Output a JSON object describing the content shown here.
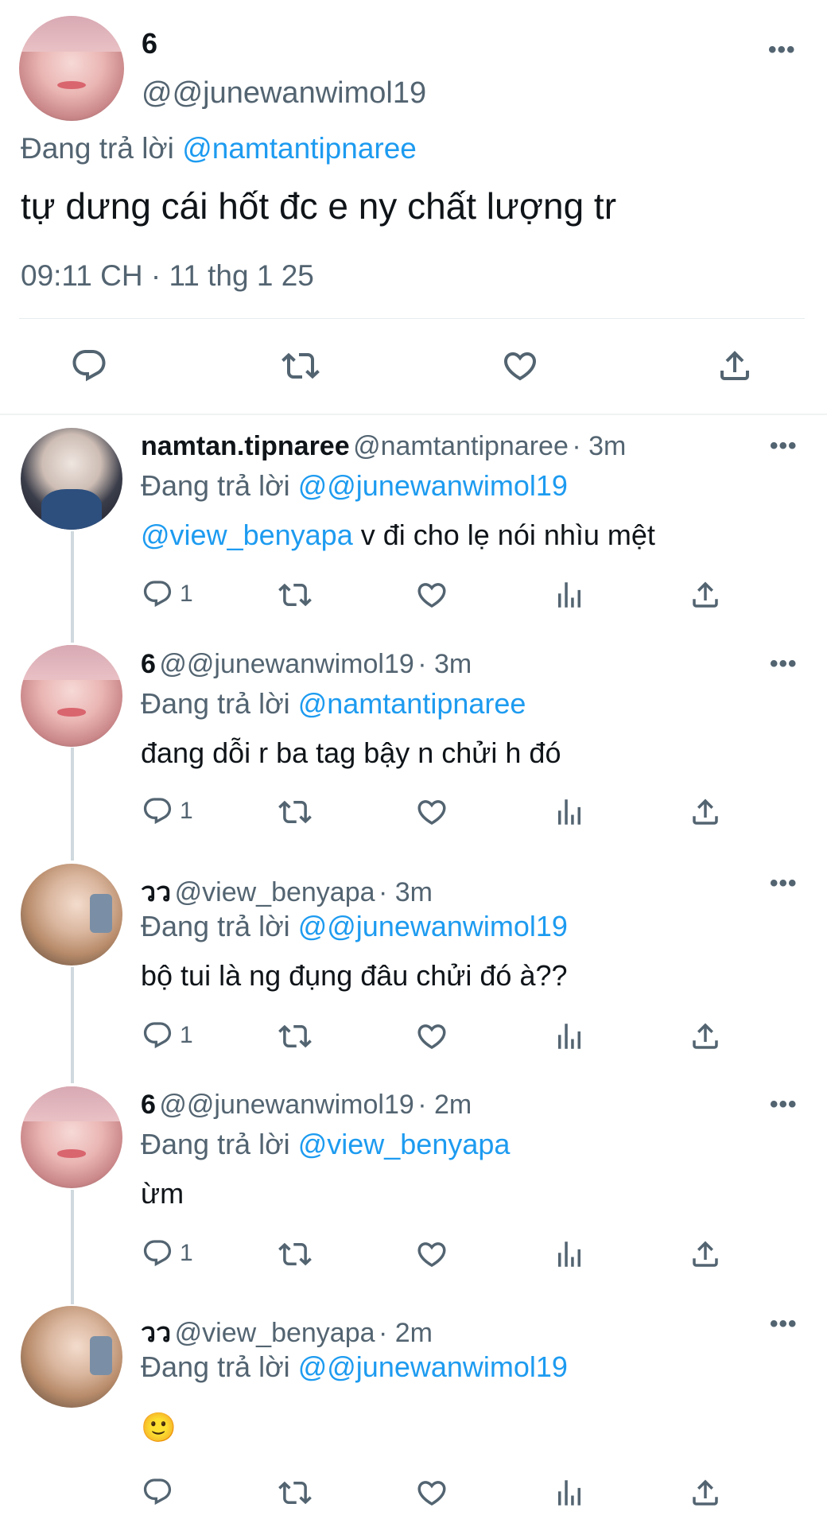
{
  "main_tweet": {
    "name": "6",
    "handle": "@@junewanwimol19",
    "reply_prefix": "Đang trả lời",
    "reply_to": "@namtantipnaree",
    "text": "tự dưng cái hốt đc e ny chất lượng tr",
    "timestamp": "09:11 CH · 11 thg 1 25",
    "more": "•••"
  },
  "replies": [
    {
      "name": "namtan.tipnaree",
      "handle": "@namtantipnaree",
      "time": "· 3m",
      "reply_prefix": "Đang trả lời",
      "reply_to": "@@junewanwimol19",
      "mention": "@view_benyapa",
      "text": " v đi cho lẹ nói nhìu mệt",
      "reply_count": "1",
      "more": "•••"
    },
    {
      "name": "6",
      "handle": "@@junewanwimol19",
      "time": "· 3m",
      "reply_prefix": "Đang trả lời",
      "reply_to": "@namtantipnaree",
      "text": "đang dỗi r ba tag bậy n chửi h đó",
      "reply_count": "1",
      "more": "•••"
    },
    {
      "name": "วว",
      "handle": "@view_benyapa",
      "time": "· 3m",
      "reply_prefix": "Đang trả lời",
      "reply_to": "@@junewanwimol19",
      "text": "bộ tui là ng đụng đâu chửi đó à??",
      "reply_count": "1",
      "more": "•••"
    },
    {
      "name": "6",
      "handle": "@@junewanwimol19",
      "time": "· 2m",
      "reply_prefix": "Đang trả lời",
      "reply_to": "@view_benyapa",
      "text": "ừm",
      "reply_count": "1",
      "more": "•••"
    },
    {
      "name": "วว",
      "handle": "@view_benyapa",
      "time": "· 2m",
      "reply_prefix": "Đang trả lời",
      "reply_to": "@@junewanwimol19",
      "text": "🙂",
      "reply_count": "",
      "more": "•••"
    }
  ],
  "icons": [
    "reply-icon",
    "retweet-icon",
    "like-icon",
    "share-icon",
    "views-icon",
    "more-icon"
  ],
  "colors": {
    "link": "#1d9bf0",
    "muted": "#536471",
    "text": "#0f1419",
    "thread_line": "#cfd9de"
  }
}
